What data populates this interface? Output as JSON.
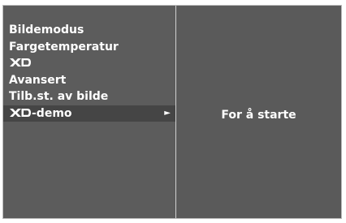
{
  "menu": {
    "items": [
      {
        "label": "Bildemodus"
      },
      {
        "label": "Fargetemperatur"
      },
      {
        "icon": "xd-logo-icon"
      },
      {
        "label": "Avansert"
      },
      {
        "label": "Tilb.st. av bilde"
      },
      {
        "icon": "xd-logo-icon",
        "label": "-demo",
        "selected": true,
        "arrow": "►"
      }
    ]
  },
  "right_panel": {
    "text": "For å starte"
  },
  "colors": {
    "panel_bg": "#5c5c5c",
    "selected_bg": "#454545",
    "text": "#ffffff",
    "divider": "#d0d0d0"
  }
}
